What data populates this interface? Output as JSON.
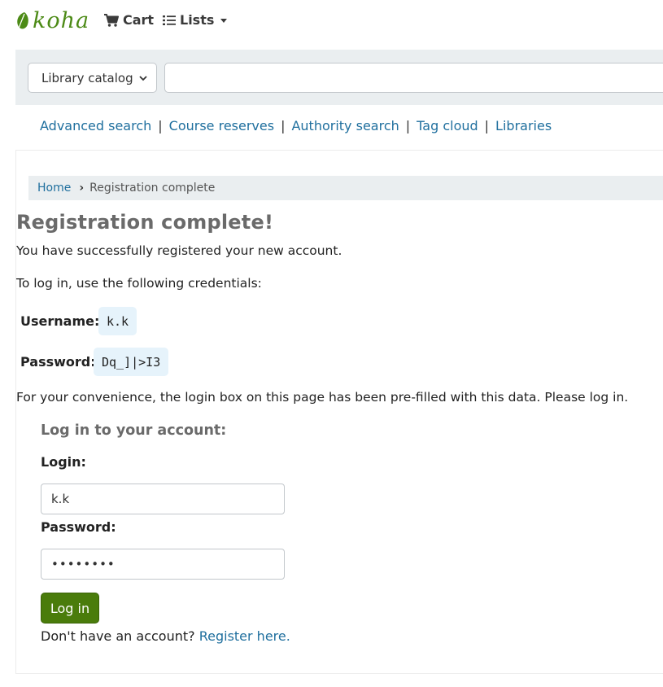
{
  "header": {
    "logo_text": "koha",
    "cart_label": "Cart",
    "lists_label": "Lists"
  },
  "search": {
    "scope_selected": "Library catalog",
    "query_value": ""
  },
  "more_searches": [
    "Advanced search",
    "Course reserves",
    "Authority search",
    "Tag cloud",
    "Libraries"
  ],
  "breadcrumb": {
    "home": "Home",
    "current": "Registration complete"
  },
  "content": {
    "title": "Registration complete!",
    "success_text": "You have successfully registered your new account.",
    "credentials_intro": "To log in, use the following credentials:",
    "username_label": "Username:",
    "username_value": "k.k",
    "password_label": "Password:",
    "password_value": "Dq_]|>I3",
    "prefill_note": "For your convenience, the login box on this page has been pre-filled with this data. Please log in."
  },
  "login": {
    "title": "Log in to your account:",
    "login_label": "Login:",
    "login_value": "k.k",
    "password_label": "Password:",
    "password_masked": "••••••••",
    "submit_label": "Log in",
    "no_account_text": "Don't have an account?",
    "register_link": "Register here."
  },
  "colors": {
    "brand_green": "#4c8a16",
    "button_green": "#4a7c0b",
    "link_blue": "#1f6f9e",
    "band_gray": "#eaeef0",
    "code_bg": "#e6f3fb"
  },
  "icons": {
    "cart": "cart-icon",
    "lists": "list-icon",
    "logo": "koha-leaf-icon"
  }
}
